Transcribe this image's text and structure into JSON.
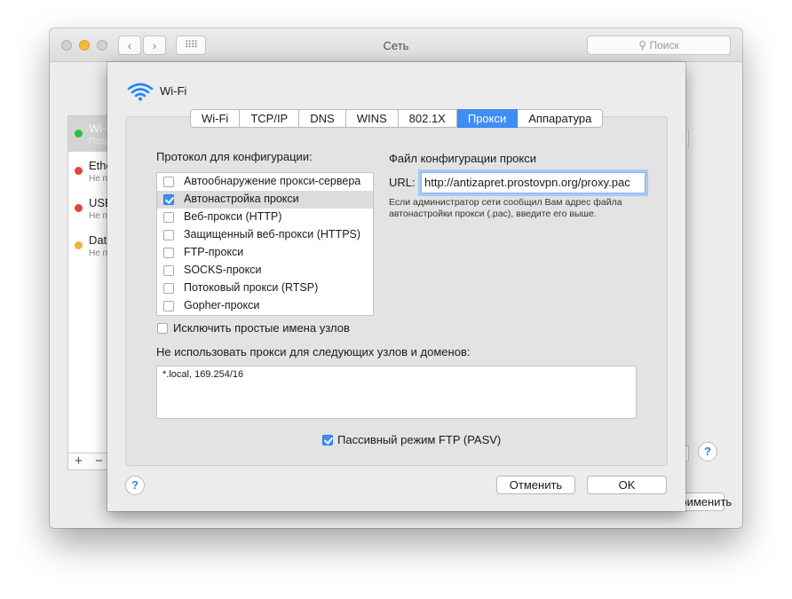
{
  "window": {
    "title": "Сеть",
    "back_label": "‹",
    "forward_label": "›",
    "grid_label": "⠿⠿",
    "search_placeholder": "Поиск",
    "services": [
      {
        "name": "Wi-Fi",
        "status": "Подключено",
        "color": "#2fbf3c"
      },
      {
        "name": "Ethernet",
        "status": "Не подключено",
        "color": "#e8413c"
      },
      {
        "name": "USB",
        "status": "Не подключено",
        "color": "#e8413c"
      },
      {
        "name": "Data",
        "status": "Не подключено",
        "color": "#f2b23a"
      }
    ],
    "add_label": "+",
    "remove_label": "−",
    "help_label": "?",
    "apply_label": "Применить"
  },
  "sheet": {
    "title": "Wi-Fi",
    "tabs": [
      "Wi-Fi",
      "TCP/IP",
      "DNS",
      "WINS",
      "802.1X",
      "Прокси",
      "Аппаратура"
    ],
    "active_tab": "Прокси",
    "protocols_label": "Протокол для конфигурации:",
    "protocols": [
      {
        "label": "Автообнаружение прокси-сервера",
        "checked": false
      },
      {
        "label": "Автонастройка прокси",
        "checked": true
      },
      {
        "label": "Веб-прокси (HTTP)",
        "checked": false
      },
      {
        "label": "Защищенный веб-прокси (HTTPS)",
        "checked": false
      },
      {
        "label": "FTP-прокси",
        "checked": false
      },
      {
        "label": "SOCKS-прокси",
        "checked": false
      },
      {
        "label": "Потоковый прокси (RTSP)",
        "checked": false
      },
      {
        "label": "Gopher-прокси",
        "checked": false
      }
    ],
    "pac_title": "Файл конфигурации прокси",
    "url_label": "URL:",
    "url_value": "http://antizapret.prostovpn.org/proxy.pac",
    "hint": "Если администратор сети сообщил Вам адрес файла автонастройки прокси (.pac), введите его выше.",
    "exclude_simple_label": "Исключить простые имена узлов",
    "exclude_simple_checked": false,
    "bypass_label": "Не использовать прокси для следующих узлов и доменов:",
    "bypass_value": "*.local, 169.254/16",
    "pasv_label": "Пассивный режим FTP (PASV)",
    "pasv_checked": true,
    "help_label": "?",
    "cancel_label": "Отменить",
    "ok_label": "OK"
  },
  "colors": {
    "accent": "#3e8ef7",
    "selection": "#dcdcdc",
    "help_icon": "#3b7be0"
  }
}
